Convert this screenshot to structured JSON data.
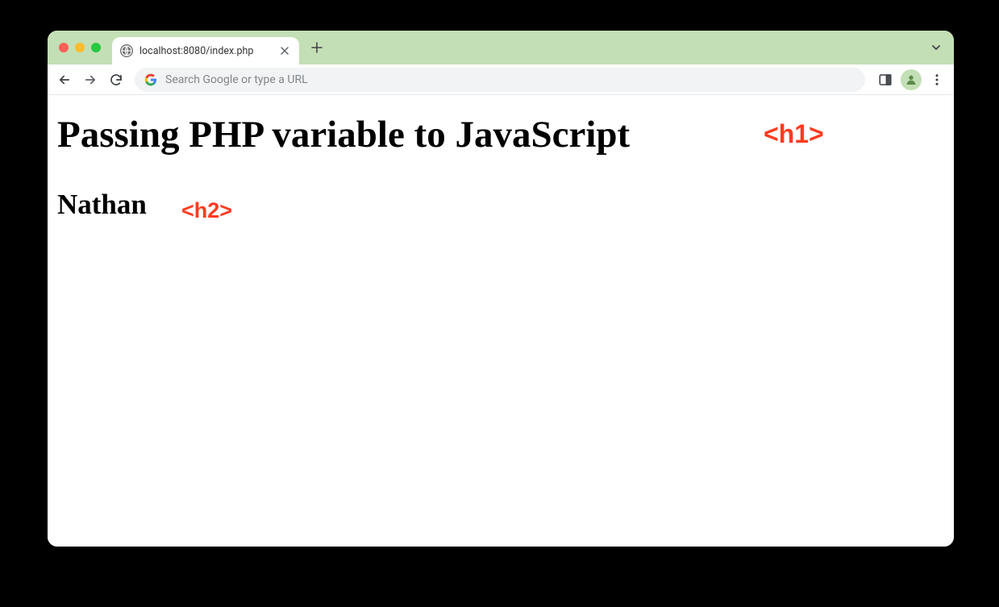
{
  "browser": {
    "tab": {
      "title": "localhost:8080/index.php"
    },
    "omnibox": {
      "placeholder": "Search Google or type a URL"
    }
  },
  "page": {
    "h1_text": "Passing PHP variable to JavaScript",
    "h2_text": "Nathan"
  },
  "annotations": {
    "h1_tag": "<h1>",
    "h2_tag": "<h2>"
  }
}
